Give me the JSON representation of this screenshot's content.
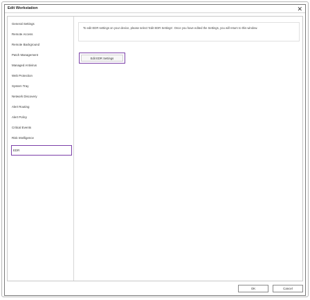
{
  "window": {
    "title": "Edit Workstation",
    "close_glyph": "✕"
  },
  "sidebar": {
    "items": [
      {
        "label": "General Settings"
      },
      {
        "label": "Remote Access"
      },
      {
        "label": "Remote Background"
      },
      {
        "label": "Patch Management"
      },
      {
        "label": "Managed Antivirus"
      },
      {
        "label": "Web Protection"
      },
      {
        "label": "System Tray"
      },
      {
        "label": "Network Discovery"
      },
      {
        "label": "Alert Routing"
      },
      {
        "label": "Alert Policy"
      },
      {
        "label": "Critical Events"
      },
      {
        "label": "Risk Intelligence"
      },
      {
        "label": "EDR"
      }
    ],
    "selected": "EDR"
  },
  "main": {
    "info_text": "To edit EDR settings on your device, please select 'Edit EDR Settings'. Once you have edited the Settings, you will return to this window.",
    "edit_button_label": "Edit EDR Settings"
  },
  "footer": {
    "ok_label": "OK",
    "cancel_label": "Cancel"
  },
  "colors": {
    "highlight": "#7b3fa8"
  }
}
